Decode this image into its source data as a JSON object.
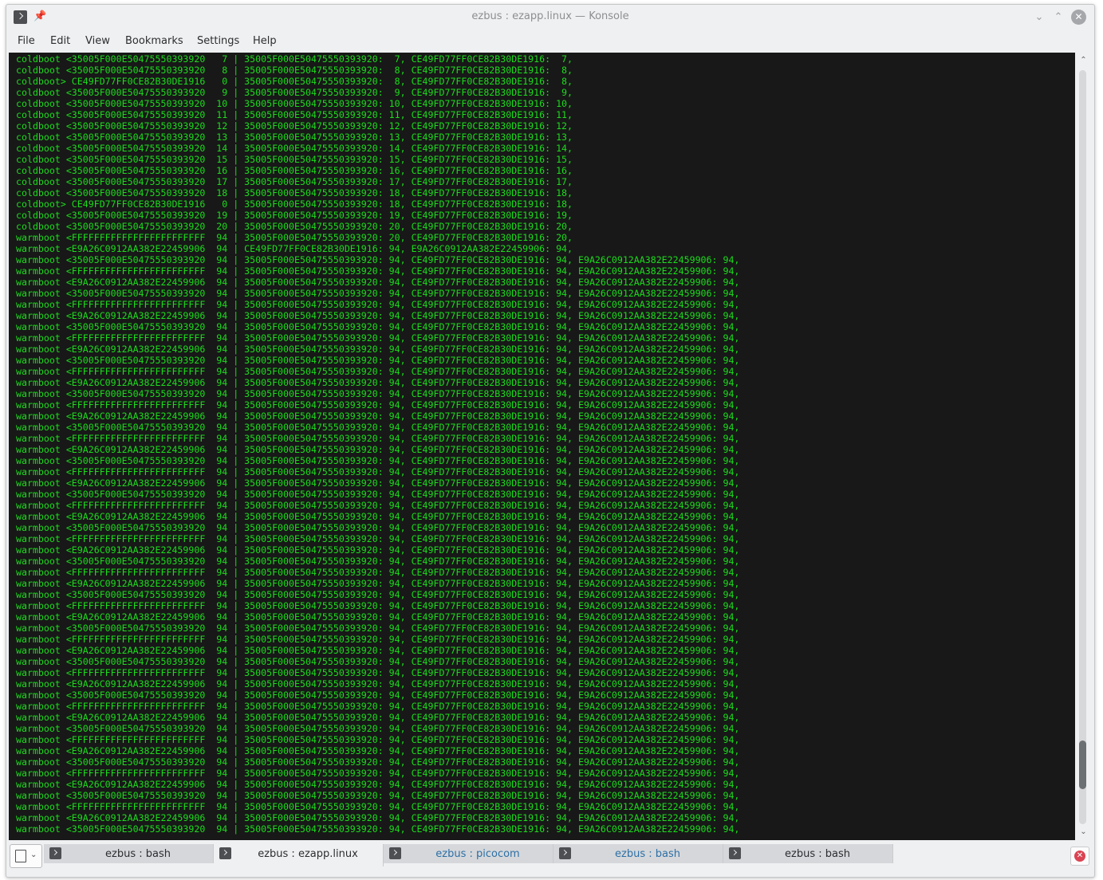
{
  "window": {
    "title": "ezbus : ezapp.linux — Konsole"
  },
  "menu": [
    "File",
    "Edit",
    "View",
    "Bookmarks",
    "Settings",
    "Help"
  ],
  "terminal": {
    "lines": [
      "coldboot <35005F000E50475550393920   7 | 35005F000E50475550393920:  7, CE49FD77FF0CE82B30DE1916:  7,",
      "coldboot <35005F000E50475550393920   8 | 35005F000E50475550393920:  8, CE49FD77FF0CE82B30DE1916:  8,",
      "coldboot> CE49FD77FF0CE82B30DE1916   0 | 35005F000E50475550393920:  8, CE49FD77FF0CE82B30DE1916:  8,",
      "coldboot <35005F000E50475550393920   9 | 35005F000E50475550393920:  9, CE49FD77FF0CE82B30DE1916:  9,",
      "coldboot <35005F000E50475550393920  10 | 35005F000E50475550393920: 10, CE49FD77FF0CE82B30DE1916: 10,",
      "coldboot <35005F000E50475550393920  11 | 35005F000E50475550393920: 11, CE49FD77FF0CE82B30DE1916: 11,",
      "coldboot <35005F000E50475550393920  12 | 35005F000E50475550393920: 12, CE49FD77FF0CE82B30DE1916: 12,",
      "coldboot <35005F000E50475550393920  13 | 35005F000E50475550393920: 13, CE49FD77FF0CE82B30DE1916: 13,",
      "coldboot <35005F000E50475550393920  14 | 35005F000E50475550393920: 14, CE49FD77FF0CE82B30DE1916: 14,",
      "coldboot <35005F000E50475550393920  15 | 35005F000E50475550393920: 15, CE49FD77FF0CE82B30DE1916: 15,",
      "coldboot <35005F000E50475550393920  16 | 35005F000E50475550393920: 16, CE49FD77FF0CE82B30DE1916: 16,",
      "coldboot <35005F000E50475550393920  17 | 35005F000E50475550393920: 17, CE49FD77FF0CE82B30DE1916: 17,",
      "coldboot <35005F000E50475550393920  18 | 35005F000E50475550393920: 18, CE49FD77FF0CE82B30DE1916: 18,",
      "coldboot> CE49FD77FF0CE82B30DE1916   0 | 35005F000E50475550393920: 18, CE49FD77FF0CE82B30DE1916: 18,",
      "coldboot <35005F000E50475550393920  19 | 35005F000E50475550393920: 19, CE49FD77FF0CE82B30DE1916: 19,",
      "coldboot <35005F000E50475550393920  20 | 35005F000E50475550393920: 20, CE49FD77FF0CE82B30DE1916: 20,",
      "warmboot <FFFFFFFFFFFFFFFFFFFFFFFF  94 | 35005F000E50475550393920: 20, CE49FD77FF0CE82B30DE1916: 20,",
      "warmboot <E9A26C0912AA382E22459906  94 | CE49FD77FF0CE82B30DE1916: 94, E9A26C0912AA382E22459906: 94,",
      "warmboot <35005F000E50475550393920  94 | 35005F000E50475550393920: 94, CE49FD77FF0CE82B30DE1916: 94, E9A26C0912AA382E22459906: 94,",
      "warmboot <FFFFFFFFFFFFFFFFFFFFFFFF  94 | 35005F000E50475550393920: 94, CE49FD77FF0CE82B30DE1916: 94, E9A26C0912AA382E22459906: 94,",
      "warmboot <E9A26C0912AA382E22459906  94 | 35005F000E50475550393920: 94, CE49FD77FF0CE82B30DE1916: 94, E9A26C0912AA382E22459906: 94,",
      "warmboot <35005F000E50475550393920  94 | 35005F000E50475550393920: 94, CE49FD77FF0CE82B30DE1916: 94, E9A26C0912AA382E22459906: 94,",
      "warmboot <FFFFFFFFFFFFFFFFFFFFFFFF  94 | 35005F000E50475550393920: 94, CE49FD77FF0CE82B30DE1916: 94, E9A26C0912AA382E22459906: 94,",
      "warmboot <E9A26C0912AA382E22459906  94 | 35005F000E50475550393920: 94, CE49FD77FF0CE82B30DE1916: 94, E9A26C0912AA382E22459906: 94,",
      "warmboot <35005F000E50475550393920  94 | 35005F000E50475550393920: 94, CE49FD77FF0CE82B30DE1916: 94, E9A26C0912AA382E22459906: 94,",
      "warmboot <FFFFFFFFFFFFFFFFFFFFFFFF  94 | 35005F000E50475550393920: 94, CE49FD77FF0CE82B30DE1916: 94, E9A26C0912AA382E22459906: 94,",
      "warmboot <E9A26C0912AA382E22459906  94 | 35005F000E50475550393920: 94, CE49FD77FF0CE82B30DE1916: 94, E9A26C0912AA382E22459906: 94,",
      "warmboot <35005F000E50475550393920  94 | 35005F000E50475550393920: 94, CE49FD77FF0CE82B30DE1916: 94, E9A26C0912AA382E22459906: 94,",
      "warmboot <FFFFFFFFFFFFFFFFFFFFFFFF  94 | 35005F000E50475550393920: 94, CE49FD77FF0CE82B30DE1916: 94, E9A26C0912AA382E22459906: 94,",
      "warmboot <E9A26C0912AA382E22459906  94 | 35005F000E50475550393920: 94, CE49FD77FF0CE82B30DE1916: 94, E9A26C0912AA382E22459906: 94,",
      "warmboot <35005F000E50475550393920  94 | 35005F000E50475550393920: 94, CE49FD77FF0CE82B30DE1916: 94, E9A26C0912AA382E22459906: 94,",
      "warmboot <FFFFFFFFFFFFFFFFFFFFFFFF  94 | 35005F000E50475550393920: 94, CE49FD77FF0CE82B30DE1916: 94, E9A26C0912AA382E22459906: 94,",
      "warmboot <E9A26C0912AA382E22459906  94 | 35005F000E50475550393920: 94, CE49FD77FF0CE82B30DE1916: 94, E9A26C0912AA382E22459906: 94,",
      "warmboot <35005F000E50475550393920  94 | 35005F000E50475550393920: 94, CE49FD77FF0CE82B30DE1916: 94, E9A26C0912AA382E22459906: 94,",
      "warmboot <FFFFFFFFFFFFFFFFFFFFFFFF  94 | 35005F000E50475550393920: 94, CE49FD77FF0CE82B30DE1916: 94, E9A26C0912AA382E22459906: 94,",
      "warmboot <E9A26C0912AA382E22459906  94 | 35005F000E50475550393920: 94, CE49FD77FF0CE82B30DE1916: 94, E9A26C0912AA382E22459906: 94,",
      "warmboot <35005F000E50475550393920  94 | 35005F000E50475550393920: 94, CE49FD77FF0CE82B30DE1916: 94, E9A26C0912AA382E22459906: 94,",
      "warmboot <FFFFFFFFFFFFFFFFFFFFFFFF  94 | 35005F000E50475550393920: 94, CE49FD77FF0CE82B30DE1916: 94, E9A26C0912AA382E22459906: 94,",
      "warmboot <E9A26C0912AA382E22459906  94 | 35005F000E50475550393920: 94, CE49FD77FF0CE82B30DE1916: 94, E9A26C0912AA382E22459906: 94,",
      "warmboot <35005F000E50475550393920  94 | 35005F000E50475550393920: 94, CE49FD77FF0CE82B30DE1916: 94, E9A26C0912AA382E22459906: 94,",
      "warmboot <FFFFFFFFFFFFFFFFFFFFFFFF  94 | 35005F000E50475550393920: 94, CE49FD77FF0CE82B30DE1916: 94, E9A26C0912AA382E22459906: 94,",
      "warmboot <E9A26C0912AA382E22459906  94 | 35005F000E50475550393920: 94, CE49FD77FF0CE82B30DE1916: 94, E9A26C0912AA382E22459906: 94,",
      "warmboot <35005F000E50475550393920  94 | 35005F000E50475550393920: 94, CE49FD77FF0CE82B30DE1916: 94, E9A26C0912AA382E22459906: 94,",
      "warmboot <FFFFFFFFFFFFFFFFFFFFFFFF  94 | 35005F000E50475550393920: 94, CE49FD77FF0CE82B30DE1916: 94, E9A26C0912AA382E22459906: 94,",
      "warmboot <E9A26C0912AA382E22459906  94 | 35005F000E50475550393920: 94, CE49FD77FF0CE82B30DE1916: 94, E9A26C0912AA382E22459906: 94,",
      "warmboot <35005F000E50475550393920  94 | 35005F000E50475550393920: 94, CE49FD77FF0CE82B30DE1916: 94, E9A26C0912AA382E22459906: 94,",
      "warmboot <FFFFFFFFFFFFFFFFFFFFFFFF  94 | 35005F000E50475550393920: 94, CE49FD77FF0CE82B30DE1916: 94, E9A26C0912AA382E22459906: 94,",
      "warmboot <E9A26C0912AA382E22459906  94 | 35005F000E50475550393920: 94, CE49FD77FF0CE82B30DE1916: 94, E9A26C0912AA382E22459906: 94,",
      "warmboot <35005F000E50475550393920  94 | 35005F000E50475550393920: 94, CE49FD77FF0CE82B30DE1916: 94, E9A26C0912AA382E22459906: 94,",
      "warmboot <FFFFFFFFFFFFFFFFFFFFFFFF  94 | 35005F000E50475550393920: 94, CE49FD77FF0CE82B30DE1916: 94, E9A26C0912AA382E22459906: 94,",
      "warmboot <E9A26C0912AA382E22459906  94 | 35005F000E50475550393920: 94, CE49FD77FF0CE82B30DE1916: 94, E9A26C0912AA382E22459906: 94,",
      "warmboot <35005F000E50475550393920  94 | 35005F000E50475550393920: 94, CE49FD77FF0CE82B30DE1916: 94, E9A26C0912AA382E22459906: 94,",
      "warmboot <FFFFFFFFFFFFFFFFFFFFFFFF  94 | 35005F000E50475550393920: 94, CE49FD77FF0CE82B30DE1916: 94, E9A26C0912AA382E22459906: 94,",
      "warmboot <E9A26C0912AA382E22459906  94 | 35005F000E50475550393920: 94, CE49FD77FF0CE82B30DE1916: 94, E9A26C0912AA382E22459906: 94,",
      "warmboot <35005F000E50475550393920  94 | 35005F000E50475550393920: 94, CE49FD77FF0CE82B30DE1916: 94, E9A26C0912AA382E22459906: 94,",
      "warmboot <FFFFFFFFFFFFFFFFFFFFFFFF  94 | 35005F000E50475550393920: 94, CE49FD77FF0CE82B30DE1916: 94, E9A26C0912AA382E22459906: 94,",
      "warmboot <E9A26C0912AA382E22459906  94 | 35005F000E50475550393920: 94, CE49FD77FF0CE82B30DE1916: 94, E9A26C0912AA382E22459906: 94,",
      "warmboot <35005F000E50475550393920  94 | 35005F000E50475550393920: 94, CE49FD77FF0CE82B30DE1916: 94, E9A26C0912AA382E22459906: 94,",
      "warmboot <FFFFFFFFFFFFFFFFFFFFFFFF  94 | 35005F000E50475550393920: 94, CE49FD77FF0CE82B30DE1916: 94, E9A26C0912AA382E22459906: 94,",
      "warmboot <E9A26C0912AA382E22459906  94 | 35005F000E50475550393920: 94, CE49FD77FF0CE82B30DE1916: 94, E9A26C0912AA382E22459906: 94,",
      "warmboot <35005F000E50475550393920  94 | 35005F000E50475550393920: 94, CE49FD77FF0CE82B30DE1916: 94, E9A26C0912AA382E22459906: 94,",
      "warmboot <FFFFFFFFFFFFFFFFFFFFFFFF  94 | 35005F000E50475550393920: 94, CE49FD77FF0CE82B30DE1916: 94, E9A26C0912AA382E22459906: 94,",
      "warmboot <E9A26C0912AA382E22459906  94 | 35005F000E50475550393920: 94, CE49FD77FF0CE82B30DE1916: 94, E9A26C0912AA382E22459906: 94,",
      "warmboot <35005F000E50475550393920  94 | 35005F000E50475550393920: 94, CE49FD77FF0CE82B30DE1916: 94, E9A26C0912AA382E22459906: 94,",
      "warmboot <FFFFFFFFFFFFFFFFFFFFFFFF  94 | 35005F000E50475550393920: 94, CE49FD77FF0CE82B30DE1916: 94, E9A26C0912AA382E22459906: 94,",
      "warmboot <E9A26C0912AA382E22459906  94 | 35005F000E50475550393920: 94, CE49FD77FF0CE82B30DE1916: 94, E9A26C0912AA382E22459906: 94,",
      "warmboot <35005F000E50475550393920  94 | 35005F000E50475550393920: 94, CE49FD77FF0CE82B30DE1916: 94, E9A26C0912AA382E22459906: 94,",
      "warmboot <FFFFFFFFFFFFFFFFFFFFFFFF  94 | 35005F000E50475550393920: 94, CE49FD77FF0CE82B30DE1916: 94, E9A26C0912AA382E22459906: 94,",
      "warmboot <E9A26C0912AA382E22459906  94 | 35005F000E50475550393920: 94, CE49FD77FF0CE82B30DE1916: 94, E9A26C0912AA382E22459906: 94,",
      "warmboot <35005F000E50475550393920  94 | 35005F000E50475550393920: 94, CE49FD77FF0CE82B30DE1916: 94, E9A26C0912AA382E22459906: 94,"
    ],
    "scroll_position": 0.95
  },
  "tabs": [
    {
      "label": "ezbus : bash",
      "state": "inactive"
    },
    {
      "label": "ezbus : ezapp.linux",
      "state": "active"
    },
    {
      "label": "ezbus : picocom",
      "state": "activity"
    },
    {
      "label": "ezbus : bash",
      "state": "activity"
    },
    {
      "label": "ezbus : bash",
      "state": "inactive"
    }
  ],
  "colors": {
    "terminal_bg": "#181818",
    "terminal_fg": "#1cdc1c",
    "activity_tab_text": "#2d6fa6",
    "close_red": "#da4453"
  }
}
